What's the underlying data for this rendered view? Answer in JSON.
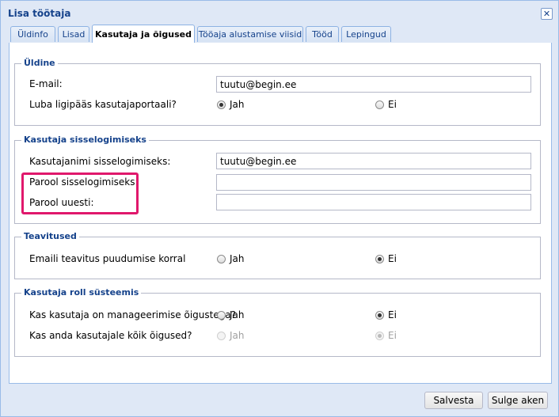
{
  "window": {
    "title": "Lisa töötaja"
  },
  "tabs": [
    {
      "label": "Üldinfo"
    },
    {
      "label": "Lisad"
    },
    {
      "label": "Kasutaja ja õigused"
    },
    {
      "label": "Tööaja alustamise viisid"
    },
    {
      "label": "Tööd"
    },
    {
      "label": "Lepingud"
    }
  ],
  "active_tab": "Kasutaja ja õigused",
  "general": {
    "legend": "Üldine",
    "email_label": "E-mail:",
    "email_value": "tuutu@begin.ee",
    "portal_label": "Luba ligipääs kasutajaportaali?",
    "yes": "Jah",
    "no": "Ei",
    "portal_selected": "Jah"
  },
  "login": {
    "legend": "Kasutaja sisselogimiseks",
    "username_label": "Kasutajanimi sisselogimiseks:",
    "username_value": "tuutu@begin.ee",
    "password_label": "Parool sisselogimiseks:",
    "password_value": "",
    "password_repeat_label": "Parool uuesti:",
    "password_repeat_value": ""
  },
  "notifications": {
    "legend": "Teavitused",
    "absence_label": "Emaili teavitus puudumise korral",
    "yes": "Jah",
    "no": "Ei",
    "absence_selected": "Ei"
  },
  "role": {
    "legend": "Kasutaja roll süsteemis",
    "manager_label": "Kas kasutaja on manageerimise õigustega?",
    "manager_selected": "Ei",
    "all_rights_label": "Kas anda kasutajale kõik õigused?",
    "all_rights_selected": "Ei",
    "all_rights_disabled": true,
    "yes": "Jah",
    "no": "Ei"
  },
  "footer": {
    "save_label": "Salvesta",
    "close_label": "Sulge aken"
  },
  "colors": {
    "highlight": "#e0186c",
    "legend_text": "#15428b",
    "window_bg": "#dfe8f6"
  }
}
